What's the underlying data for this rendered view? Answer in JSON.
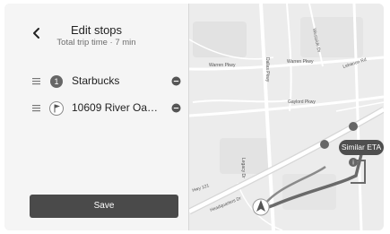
{
  "panel": {
    "title": "Edit stops",
    "subtitle": "Total trip time  ·  7 min",
    "back_icon": "chevron-left-icon",
    "stops": [
      {
        "label": "Starbucks",
        "marker": "1",
        "marker_icon": "numbered-stop-icon"
      },
      {
        "label": "10609 River Oa…",
        "marker": "",
        "marker_icon": "flag-icon"
      }
    ],
    "save_label": "Save"
  },
  "map": {
    "roads": {
      "warren": "Warren Pkwy",
      "warren2": "Warren Pkwy",
      "gaylord": "Gaylord Pkwy",
      "legacy": "Legacy Dr",
      "hwy121": "Hwy 121",
      "lebanon": "Lebanon Rd",
      "dallas": "Dallas Pkwy",
      "headquarters": "Headquarters Dr",
      "westside": "Westside Dr"
    },
    "eta_bubble": "Similar ETA",
    "eta_badge": "i"
  },
  "colors": {
    "panel_bg": "#f5f5f5",
    "map_bg": "#ededed",
    "route": "#6a6a6a",
    "button_bg": "#4a4a4a",
    "marker": "#666666"
  }
}
